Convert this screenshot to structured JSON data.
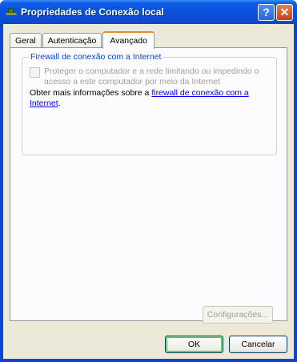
{
  "window": {
    "title": "Propriedades de Conexão local",
    "help_label": "?",
    "close_label": "✕"
  },
  "tabs": [
    {
      "label": "Geral",
      "active": false
    },
    {
      "label": "Autenticação",
      "active": false
    },
    {
      "label": "Avançado",
      "active": true
    }
  ],
  "firewall": {
    "group_title": "Firewall de conexão com a Internet",
    "checkbox_label": "Proteger o computador e a rede limitando ou impedindo o acesso a este computador por meio da Internet",
    "checkbox_checked": false,
    "checkbox_enabled": false,
    "info_prefix": "Obter mais informações sobre a ",
    "info_link": "firewall de conexão com a Internet",
    "info_suffix": "."
  },
  "buttons": {
    "settings_label": "Configurações...",
    "ok_label": "OK",
    "cancel_label": "Cancelar"
  },
  "colors": {
    "titlebar": "#0a53dc",
    "group_title": "#0046d5",
    "link": "#0000ff",
    "active_tab_accent": "#e68b2c"
  }
}
